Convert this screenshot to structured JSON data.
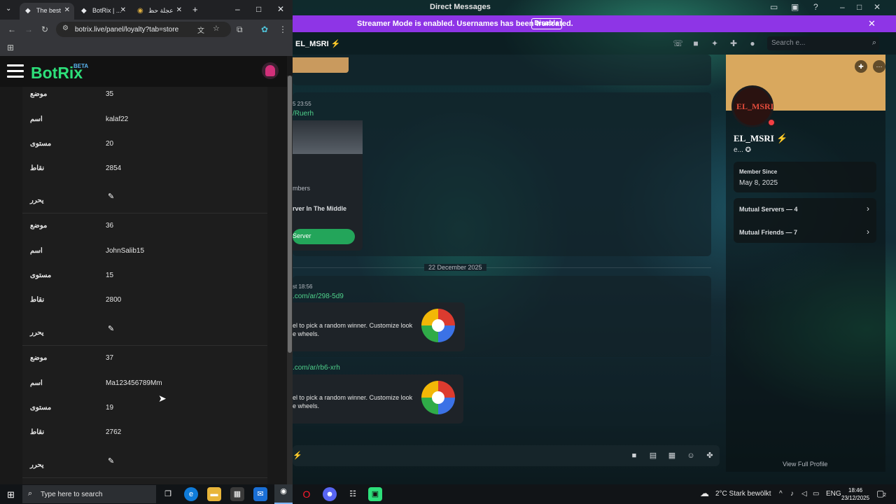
{
  "discord": {
    "window_title": "Direct Messages",
    "streamer_banner": {
      "text": "Streamer Mode is enabled. Usernames has been truncated.",
      "button": "Disable"
    },
    "channel_user": "EL_MSRI ⚡",
    "search_placeholder": "Search e...",
    "messages": {
      "timestamp1": "5 23:55",
      "link1": "/Ruerh",
      "invite_members": "mbers",
      "invite_name": "rver In The Middle",
      "invite_button": "Server",
      "date_divider": "22 December 2025",
      "timestamp2": "st 18:56",
      "link2": ".com/ar/298-5d9",
      "embed_text1": "el to pick a random winner. Customize look",
      "embed_text2": "e wheels.",
      "link3": ".com/ar/rb6-xrh",
      "embed_text3": "el to pick a random winner. Customize look",
      "embed_text4": "e wheels."
    },
    "profile": {
      "avatar_text": "EL_MSRI",
      "name": "EL_MSRI ⚡",
      "subtitle": "e... ✪",
      "member_since_label": "Member Since",
      "member_since_value": "May 8, 2025",
      "mutual_servers": "Mutual Servers — 4",
      "mutual_friends": "Mutual Friends — 7",
      "view_full": "View Full Profile"
    }
  },
  "chrome": {
    "tabs": [
      {
        "title": "The best",
        "favicon": "botrix-icon"
      },
      {
        "title": "BotRix | ...",
        "favicon": "botrix-icon"
      },
      {
        "title": "عجلة حظ",
        "favicon": "wheel-icon"
      }
    ],
    "url": "botrix.live/panel/loyalty?tab=store"
  },
  "botrix": {
    "logo": "BotRix",
    "badge": "BETA",
    "entries": [
      {
        "position_label": "موضع",
        "position": "35",
        "name_label": "اسم",
        "name": "kalaf22",
        "level_label": "مستوى",
        "level": "20",
        "points_label": "نقاط",
        "points": "2854",
        "edit_label": "يحرر"
      },
      {
        "position_label": "موضع",
        "position": "36",
        "name_label": "اسم",
        "name": "JohnSalib15",
        "level_label": "مستوى",
        "level": "15",
        "points_label": "نقاط",
        "points": "2800",
        "edit_label": "يحرر"
      },
      {
        "position_label": "موضع",
        "position": "37",
        "name_label": "اسم",
        "name": "Ma123456789Mm",
        "level_label": "مستوى",
        "level": "19",
        "points_label": "نقاط",
        "points": "2762",
        "edit_label": "يحرر"
      }
    ]
  },
  "taskbar": {
    "search_placeholder": "Type here to search",
    "weather": "2°C  Stark bewölkt",
    "language": "ENG",
    "time": "18:46",
    "date": "23/12/2025",
    "notifications": "2"
  },
  "colors": {
    "botrix_green": "#2ddf7a",
    "streamer_purple": "#8e35e6",
    "discord_link": "#4fd18b"
  }
}
